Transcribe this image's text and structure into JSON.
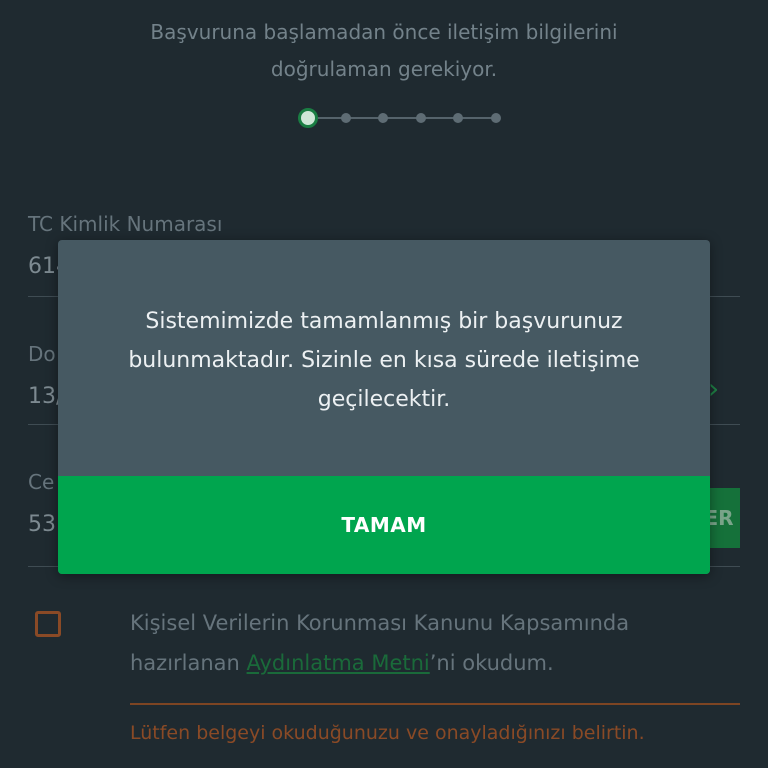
{
  "intro": {
    "line1": "Başvuruna başlamadan önce iletişim bilgilerini",
    "line2": "doğrulaman gerekiyor."
  },
  "stepper": {
    "total_steps": 6,
    "current_step": 1
  },
  "form": {
    "tc": {
      "label": "TC Kimlik Numarası",
      "value": "614"
    },
    "dob": {
      "label": "Do",
      "value": "13/"
    },
    "phone": {
      "label": "Ce",
      "value": "53",
      "button_label": "ER"
    }
  },
  "consent": {
    "text_before": "Kişisel Verilerin Korunması Kanunu Kapsamında hazırlanan ",
    "link": "Aydınlatma Metni",
    "text_after": "’ni okudum.",
    "warning": "Lütfen belgeyi okuduğunuzu ve onayladığınızı belirtin."
  },
  "dialog": {
    "message": "Sistemimizde tamamlanmış bir başvurunuz bulunmaktadır. Sizinle en kısa sürede iletişime geçilecektir.",
    "ok_label": "TAMAM"
  },
  "colors": {
    "accent": "#00a54e",
    "dialog_bg": "#465962",
    "warning": "#8a4a26",
    "background": "#1f2a30"
  }
}
